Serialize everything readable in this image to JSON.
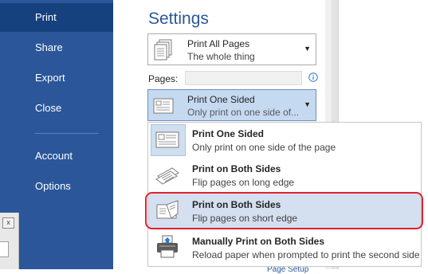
{
  "sidebar": {
    "items": [
      {
        "label": "Print",
        "active": true
      },
      {
        "label": "Share"
      },
      {
        "label": "Export"
      },
      {
        "label": "Close"
      },
      {
        "label": "Account"
      },
      {
        "label": "Options"
      }
    ]
  },
  "settings": {
    "title": "Settings",
    "print_range": {
      "title": "Print All Pages",
      "subtitle": "The whole thing"
    },
    "pages_label": "Pages:",
    "sides": {
      "title": "Print One Sided",
      "subtitle": "Only print on one side of..."
    }
  },
  "menu": {
    "items": [
      {
        "title": "Print One Sided",
        "subtitle": "Only print on one side of the page",
        "icon": "one-sided-icon"
      },
      {
        "title": "Print on Both Sides",
        "subtitle": "Flip pages on long edge",
        "icon": "long-edge-icon"
      },
      {
        "title": "Print on Both Sides",
        "subtitle": "Flip pages on short edge",
        "icon": "short-edge-icon"
      },
      {
        "title": "Manually Print on Both Sides",
        "subtitle": "Reload paper when prompted to print the second side",
        "icon": "printer-icon"
      }
    ]
  },
  "colors": {
    "accent": "#2b579a",
    "highlight": "#e3222b",
    "hover": "#d4dff0"
  },
  "under_window": {
    "close_glyph": "x"
  },
  "bottom_link": "Page Setup"
}
